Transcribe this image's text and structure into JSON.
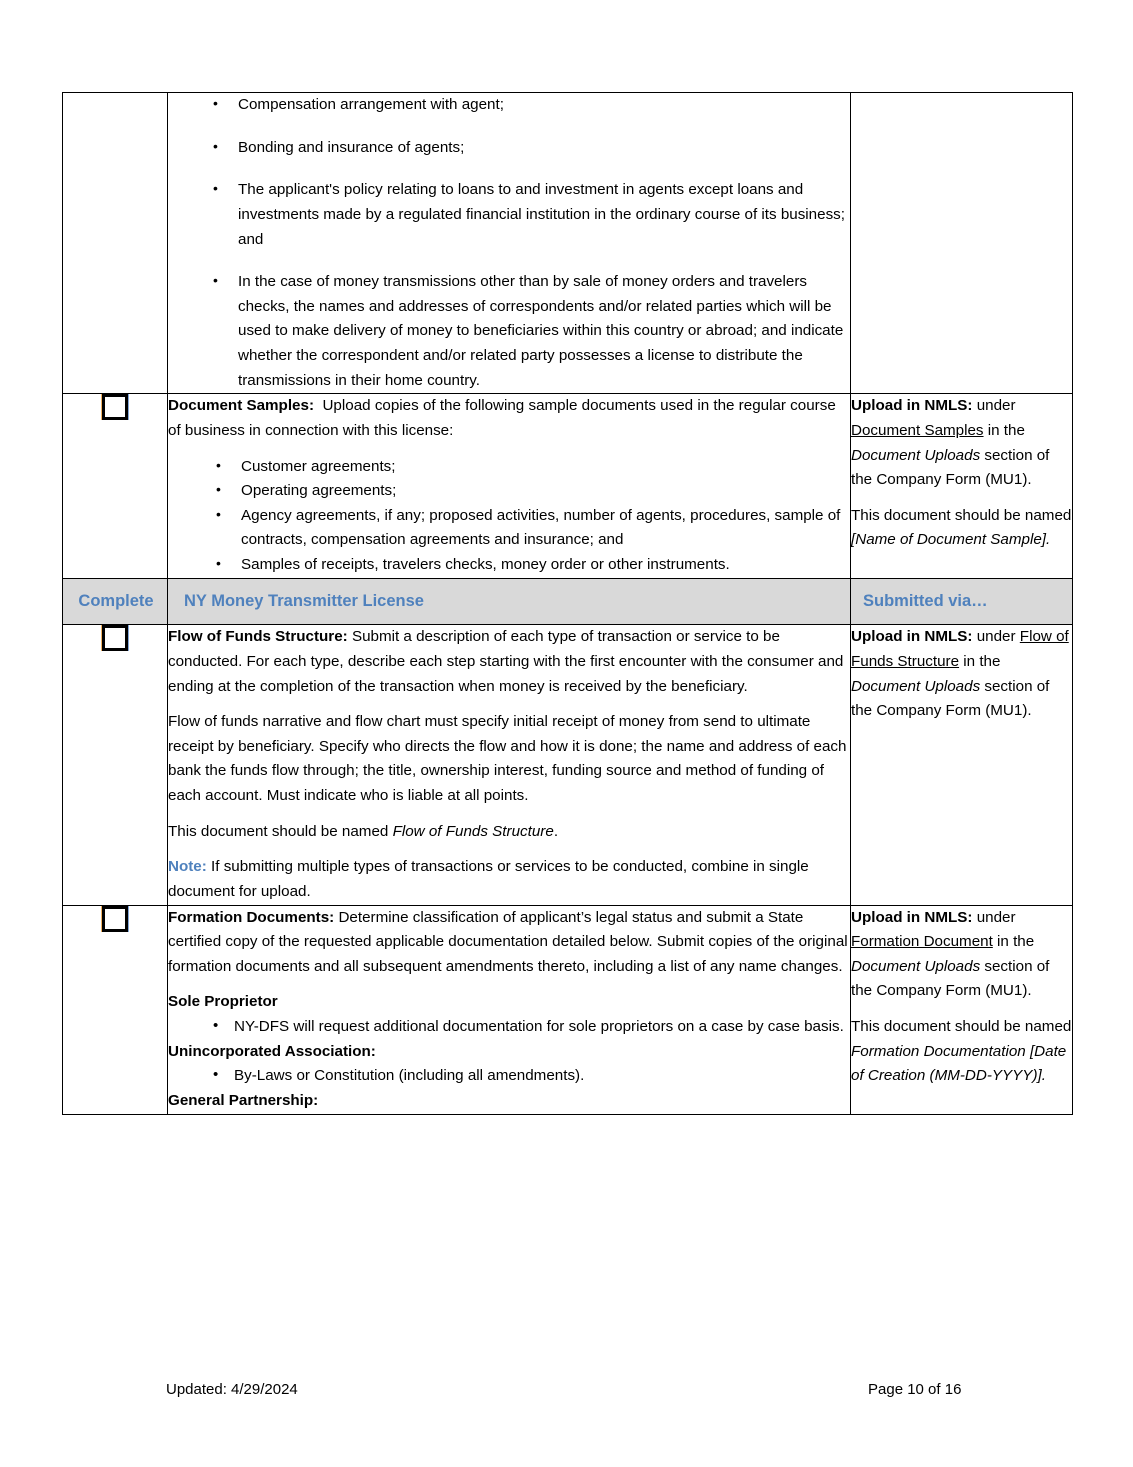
{
  "document": {
    "footer": {
      "updated_label": "Updated:  4/29/2024",
      "page_label": "Page 10 of 16"
    },
    "colors": {
      "accent_blue": "#4F81BD",
      "header_fill": "#D9D9D9",
      "border": "#000000"
    }
  },
  "rows": {
    "continued_bullets": {
      "items": [
        "Compensation arrangement with agent;",
        "Bonding and insurance of agents;",
        "The applicant's policy relating to loans to and investment in agents except loans and investments made by a regulated financial institution in the ordinary course of its business; and",
        "In the case of money transmissions other than by sale of money orders and travelers checks, the names and addresses of correspondents and/or related parties which will be used to make delivery of money to beneficiaries within this country or abroad; and indicate whether the correspondent and/or related party possesses a license to distribute the transmissions in their home country."
      ]
    },
    "document_samples": {
      "title": "Document Samples:",
      "intro": "Upload copies of the following sample documents used in the regular course of business in connection with this license:",
      "bullets": [
        "Customer agreements;",
        "Operating agreements;",
        "Agency agreements, if any; proposed activities, number of agents, procedures, sample of contracts, compensation agreements and insurance; and",
        "Samples of receipts, travelers checks, money order or other instruments."
      ],
      "via": {
        "lead_bold": "Upload in NMLS:",
        "text_under": " under ",
        "underlined": "Document Samples",
        "text_in": " in the ",
        "italic_1": "Document Uploads",
        "text_tail": " section of the Company Form (MU1).",
        "para2_plain": "This document should be named ",
        "para2_italic": "[Name of Document Sample]."
      }
    },
    "section_header": {
      "complete": "Complete",
      "license": "NY Money Transmitter License",
      "submitted_via": "Submitted via…"
    },
    "flow_of_funds": {
      "title": "Flow of Funds Structure:",
      "para1": " Submit a description of each type of transaction or service to be conducted. For each type, describe each step starting with the first encounter with the consumer and ending at the completion of the transaction when money is received by the beneficiary.",
      "para2": "Flow of funds narrative and flow chart must specify initial receipt of money from send to ultimate receipt by beneficiary.  Specify who directs the flow and how it is done; the name and address of each bank the funds flow through; the title, ownership interest, funding source and method of funding of each account.  Must indicate who is liable at all points.",
      "para3_plain": "This document should be named ",
      "para3_italic": "Flow of Funds Structure",
      "para3_tail": ".",
      "note_label": "Note",
      "note_text": ": If submitting multiple types of transactions or services to be conducted, combine in single document for upload.",
      "via": {
        "lead_bold": "Upload in NMLS:",
        "text_under": " under ",
        "underlined": "Flow of Funds Structure",
        "text_in": " in the ",
        "italic_1": "Document Uploads",
        "text_tail": " section of the Company Form (MU1)."
      }
    },
    "formation_documents": {
      "title": "Formation Documents:",
      "para1": " Determine classification of applicant’s legal status and submit a State certified copy of the requested applicable documentation detailed below. Submit copies of the original formation documents and all subsequent amendments thereto, including a list of any name changes.",
      "sub_sole_proprietor": "Sole Proprietor",
      "sole_proprietor_bullets": [
        "NY-DFS will request additional documentation for sole proprietors on a case by case basis."
      ],
      "sub_unincorporated": "Unincorporated Association:",
      "unincorporated_bullets": [
        "By-Laws or Constitution (including all amendments)."
      ],
      "sub_general_partnership": "General Partnership:",
      "via": {
        "lead_bold": "Upload in NMLS:",
        "text_under": " under ",
        "underlined": "Formation Document",
        "text_in": " in the ",
        "italic_1": "Document Uploads",
        "text_tail": " section of the Company Form (MU1).",
        "para2_plain": "This document should be named ",
        "para2_italic": "Formation Documentation [Date of Creation (MM-DD-YYYY)]."
      }
    }
  }
}
